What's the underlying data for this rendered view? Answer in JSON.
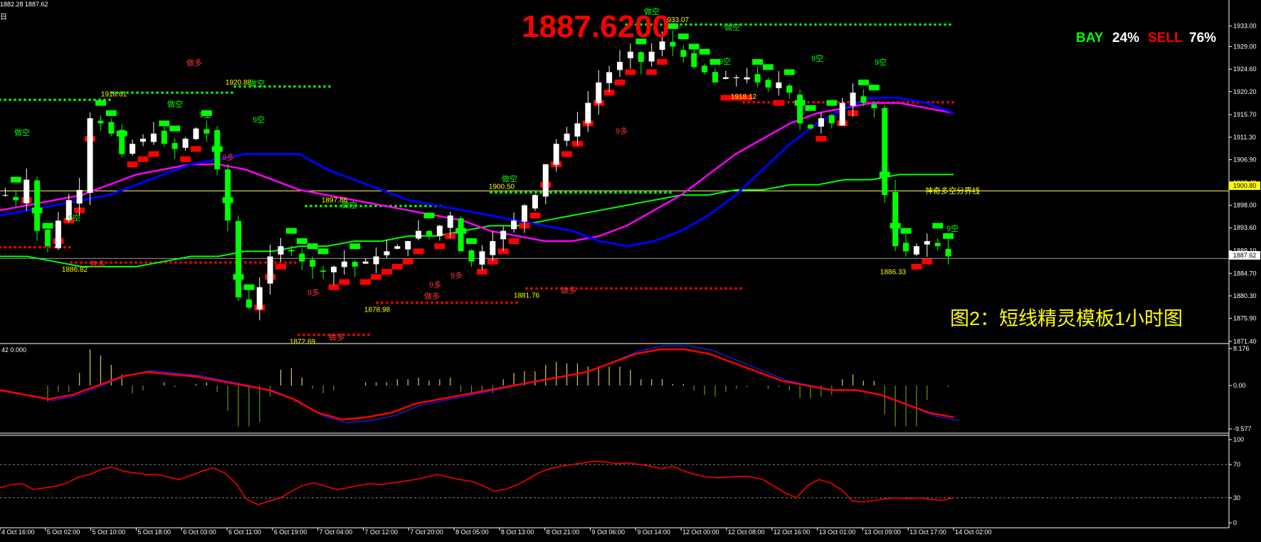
{
  "header": {
    "ohlc_text": "1882.28 1887.62",
    "timeframe_text": "日",
    "big_price": "1887.6200",
    "bay_label": "BAY",
    "bay_value": "24%",
    "sell_label": "SELL",
    "sell_value": "76%",
    "caption": "图2：短线精灵模板1小时图"
  },
  "colors": {
    "background": "#000000",
    "up_candle": "#ffffff",
    "down_candle": "#00ff00",
    "big_price": "#ff0000",
    "bay": "#00ff00",
    "sell": "#ff0000",
    "caption": "#ffff00",
    "support_dots": "#ff0000",
    "resistance_dots": "#00ff00",
    "ma_blue": "#0000ff",
    "ma_magenta": "#ff00ff",
    "ma_green": "#00ff00",
    "macd_signal": "#ff0000",
    "rsi_line": "#ff0000"
  },
  "chart_data": {
    "type": "line",
    "main_panel": {
      "ylim": [
        1871.4,
        1935.6
      ],
      "y_ticks": [
        "1933.00",
        "1929.00",
        "1924.60",
        "1920.20",
        "1915.70",
        "1911.30",
        "1906.90",
        "1902.40",
        "1898.00",
        "1893.60",
        "1889.10",
        "1884.70",
        "1880.30",
        "1875.90",
        "1871.40"
      ],
      "current_price_label": "1887.62",
      "level_line_label": "1900.80",
      "level_line_value": 1900.8,
      "current_price_value": 1887.62,
      "price_series_midline": [
        1900,
        1899,
        1903,
        1893,
        1890,
        1895,
        1899,
        1901,
        1915,
        1914,
        1912,
        1908,
        1910,
        1911,
        1912,
        1910,
        1909,
        1911,
        1913,
        1912,
        1905,
        1895,
        1880,
        1878,
        1882,
        1888,
        1890,
        1889,
        1887,
        1886,
        1885,
        1886,
        1887,
        1886,
        1887,
        1888,
        1889,
        1890,
        1891,
        1893,
        1892,
        1894,
        1896,
        1889,
        1887,
        1889,
        1891,
        1893,
        1895,
        1898,
        1900,
        1906,
        1910,
        1912,
        1914,
        1918,
        1922,
        1924,
        1926,
        1928,
        1926,
        1928,
        1930,
        1929,
        1927,
        1925,
        1924,
        1922,
        1923,
        1923,
        1923,
        1922,
        1921,
        1922,
        1920,
        1914,
        1913,
        1915,
        1914,
        1918,
        1920,
        1918,
        1917,
        1900,
        1890,
        1889,
        1890,
        1891,
        1890,
        1888
      ],
      "ma_blue": [
        1896,
        1897,
        1898,
        1899,
        1900,
        1902,
        1904,
        1906,
        1907,
        1908,
        1908,
        1908,
        1905,
        1903,
        1901,
        1899,
        1898,
        1897,
        1896,
        1895,
        1894,
        1893,
        1891,
        1890,
        1891,
        1893,
        1896,
        1900,
        1905,
        1910,
        1914,
        1917,
        1919,
        1919,
        1918,
        1916
      ],
      "ma_magenta": [
        1897,
        1898,
        1899,
        1900,
        1902,
        1904,
        1905,
        1906,
        1906,
        1905,
        1903,
        1901,
        1900,
        1899,
        1898,
        1897,
        1896,
        1895,
        1893,
        1892,
        1891,
        1891,
        1892,
        1894,
        1897,
        1900,
        1904,
        1908,
        1911,
        1914,
        1916,
        1917,
        1918,
        1918,
        1917,
        1916
      ],
      "ma_green": [
        1888,
        1888,
        1887,
        1886,
        1886,
        1886,
        1887,
        1888,
        1888,
        1889,
        1889,
        1890,
        1890,
        1891,
        1891,
        1892,
        1892,
        1893,
        1894,
        1894,
        1895,
        1896,
        1897,
        1898,
        1899,
        1900,
        1900,
        1901,
        1901,
        1902,
        1902,
        1903,
        1903,
        1904,
        1904,
        1904
      ],
      "annotations": [
        {
          "text": "1918.61",
          "value": 1918.61
        },
        {
          "text": "1920.88",
          "value": 1920.88
        },
        {
          "text": "1933.07",
          "value": 1933.07
        },
        {
          "text": "1918.12",
          "value": 1918.12
        },
        {
          "text": "1897.86",
          "value": 1897.86
        },
        {
          "text": "1900.50",
          "value": 1900.5
        },
        {
          "text": "1886.82",
          "value": 1886.82
        },
        {
          "text": "1878.98",
          "value": 1878.98
        },
        {
          "text": "1881.76",
          "value": 1881.76
        },
        {
          "text": "1872.69",
          "value": 1872.69
        },
        {
          "text": "1886.33",
          "value": 1886.33
        }
      ],
      "signal_labels": [
        "做空",
        "做空",
        "做空",
        "做空",
        "做空",
        "做空",
        "做空",
        "9空",
        "9空",
        "9空",
        "9空",
        "9空",
        "9空",
        "做多",
        "做多",
        "做多",
        "做多",
        "做多",
        "9多",
        "9多",
        "9多",
        "9多",
        "9多",
        "9空",
        "神奇多空分界线"
      ]
    },
    "macd_panel": {
      "label": "42 0.000",
      "ylim": [
        -9.577,
        8.176
      ],
      "y_ticks": [
        "8.176",
        "0.00",
        "-9.577"
      ],
      "signal_line": [
        -1,
        -2,
        -3,
        -2,
        0,
        2,
        3,
        2.5,
        2,
        1,
        0,
        -1,
        -3,
        -6,
        -7.5,
        -7,
        -6,
        -4,
        -3,
        -2,
        -1,
        0,
        1,
        2,
        3,
        5,
        7,
        8,
        8,
        7,
        5,
        3,
        1,
        0,
        -1,
        -1,
        -2,
        -4,
        -6,
        -7
      ]
    },
    "rsi_panel": {
      "ylim": [
        0,
        100
      ],
      "y_ticks": [
        "100",
        "70",
        "30",
        "0"
      ],
      "levels": [
        70,
        30
      ],
      "values": [
        42,
        46,
        47,
        40,
        42,
        44,
        48,
        55,
        58,
        64,
        67,
        62,
        60,
        58,
        58,
        55,
        52,
        57,
        62,
        66,
        60,
        48,
        28,
        22,
        26,
        30,
        38,
        45,
        48,
        44,
        40,
        42,
        45,
        47,
        46,
        48,
        50,
        52,
        55,
        58,
        55,
        52,
        50,
        45,
        38,
        40,
        45,
        52,
        60,
        65,
        68,
        70,
        72,
        74,
        73,
        71,
        72,
        70,
        68,
        65,
        68,
        62,
        58,
        55,
        54,
        55,
        56,
        55,
        52,
        44,
        36,
        30,
        45,
        52,
        48,
        40,
        26,
        25,
        27,
        29,
        30,
        29,
        30,
        28,
        27,
        30
      ],
      "line_name": ""
    },
    "x_ticks": [
      "4 Oct 16:00",
      "5 Oct 02:00",
      "5 Oct 10:00",
      "5 Oct 18:00",
      "6 Oct 03:00",
      "6 Oct 11:00",
      "6 Oct 19:00",
      "7 Oct 04:00",
      "7 Oct 12:00",
      "7 Oct 20:00",
      "8 Oct 05:00",
      "8 Oct 13:00",
      "8 Oct 21:00",
      "9 Oct 06:00",
      "9 Oct 14:00",
      "12 Oct 00:00",
      "12 Oct 08:00",
      "12 Oct 16:00",
      "13 Oct 01:00",
      "13 Oct 09:00",
      "13 Oct 17:00",
      "14 Oct 02:00"
    ]
  }
}
